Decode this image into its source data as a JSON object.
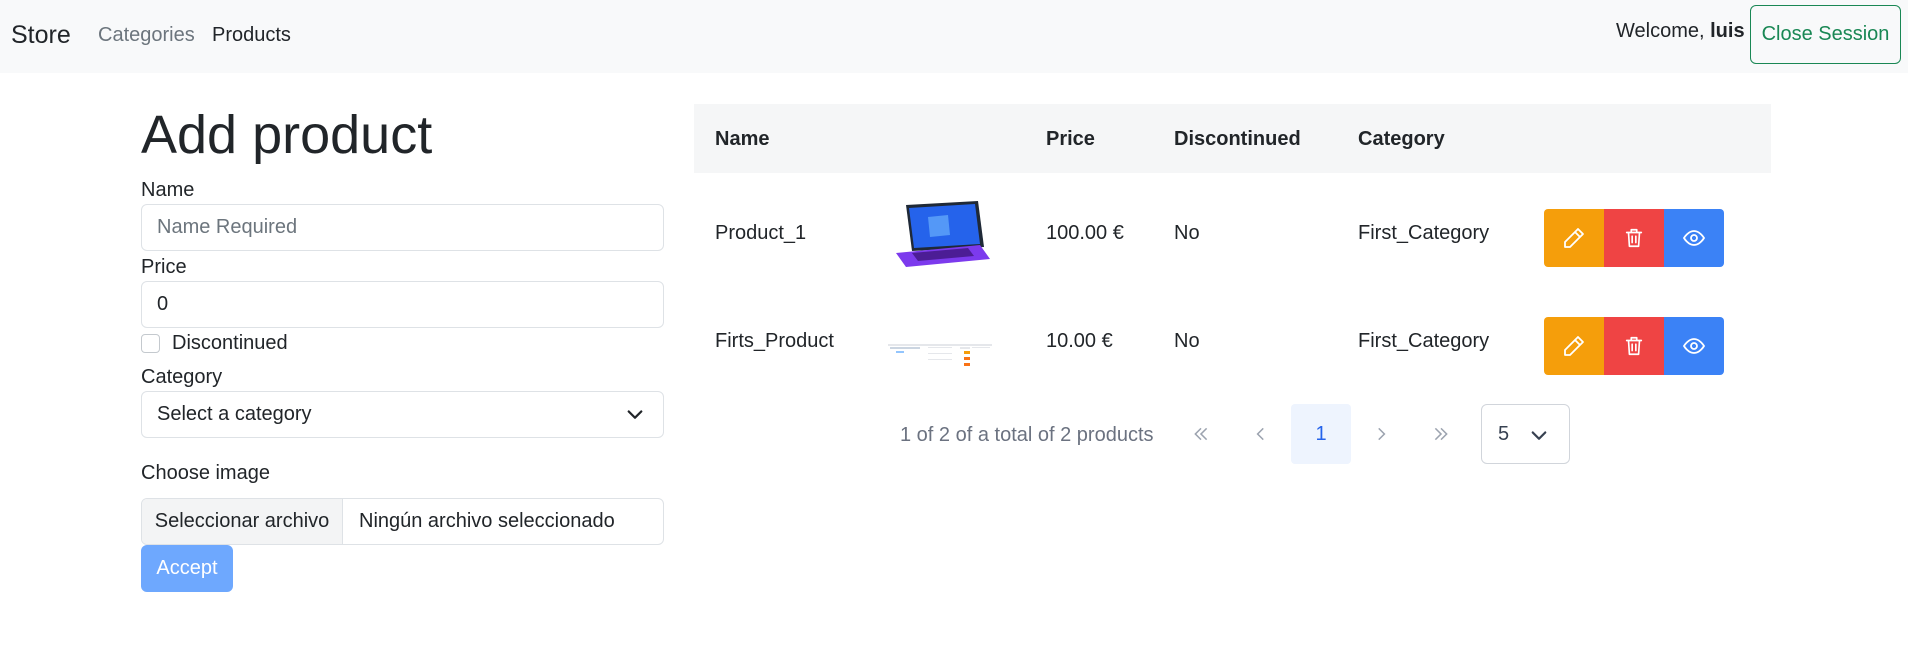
{
  "navbar": {
    "brand": "Store",
    "links": [
      {
        "label": "Categories"
      },
      {
        "label": "Products"
      }
    ],
    "welcome_prefix": "Welcome,",
    "username": "luis",
    "logout_label": "Close Session"
  },
  "form": {
    "title": "Add product",
    "name_label": "Name",
    "name_placeholder": "Name Required",
    "price_label": "Price",
    "price_value": "0",
    "discontinued_label": "Discontinued",
    "category_label": "Category",
    "category_selected": "Select a category",
    "image_label": "Choose image",
    "file_button": "Seleccionar archivo",
    "file_status": "Ningún archivo seleccionado",
    "submit_label": "Accept"
  },
  "table": {
    "headers": [
      "Name",
      "Price",
      "Discontinued",
      "Category"
    ],
    "rows": [
      {
        "name": "Product_1",
        "image": "laptop-thumbnail",
        "price": "100.00 €",
        "discontinued": "No",
        "category": "First_Category"
      },
      {
        "name": "Firts_Product",
        "image": "screenshot-thumbnail",
        "price": "10.00 €",
        "discontinued": "No",
        "category": "First_Category"
      }
    ],
    "actions": {
      "edit_icon": "pencil-icon",
      "delete_icon": "trash-icon",
      "view_icon": "eye-icon"
    },
    "action_colors": {
      "edit": "#f59e0b",
      "delete": "#ef4444",
      "view": "#3b82f6"
    }
  },
  "pagination": {
    "info": "1 of 2 of a total of 2 products",
    "current_page": "1",
    "rows_per_page": "5"
  }
}
